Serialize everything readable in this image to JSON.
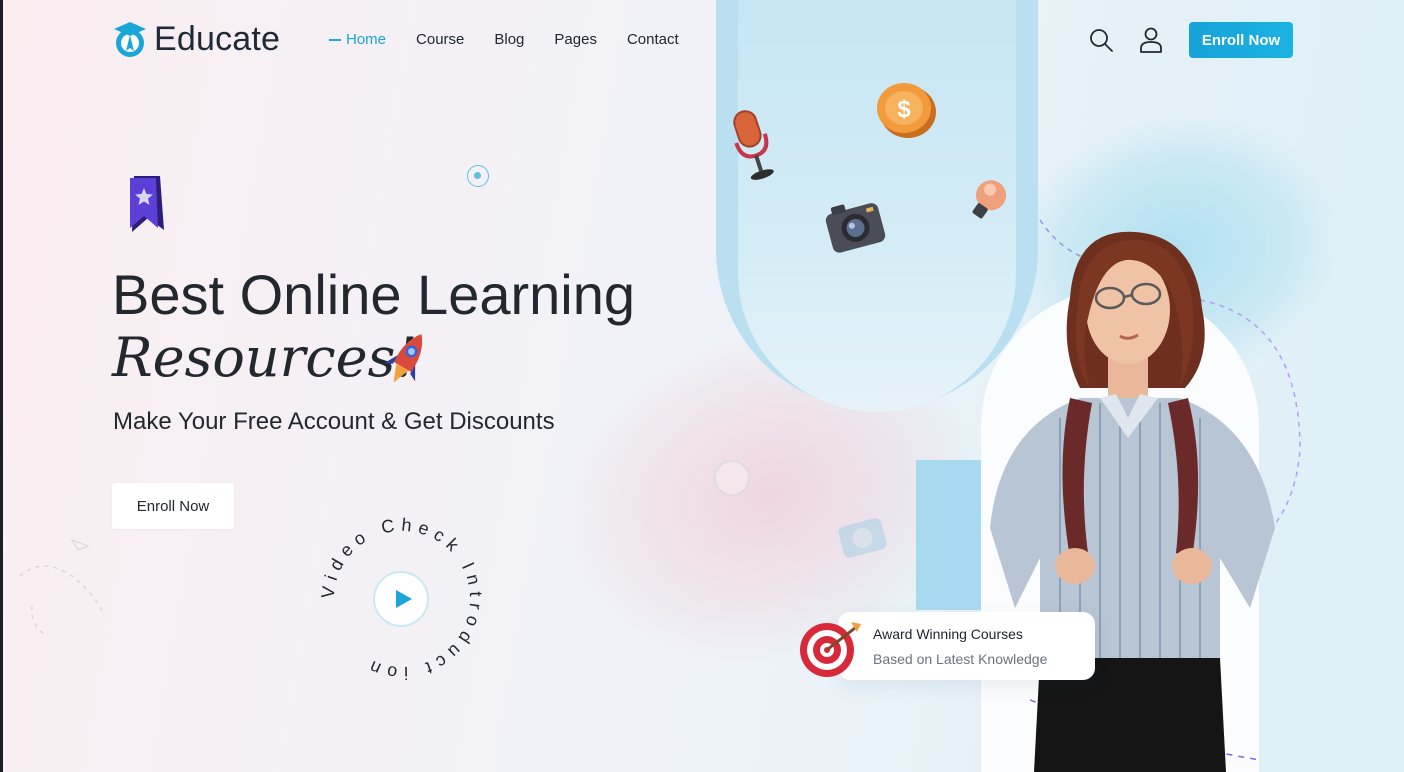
{
  "header": {
    "logo_text": "Educate",
    "nav": [
      {
        "label": "Home",
        "active": true
      },
      {
        "label": "Course",
        "active": false
      },
      {
        "label": "Blog",
        "active": false
      },
      {
        "label": "Pages",
        "active": false
      },
      {
        "label": "Contact",
        "active": false
      }
    ],
    "enroll_label": "Enroll Now"
  },
  "hero": {
    "title_line1": "Best Online Learning",
    "title_line2": "Resources!",
    "subtitle": "Make Your Free Account & Get Discounts",
    "cta_label": "Enroll Now",
    "video_circle_text": "Video Check Introduct ion"
  },
  "award": {
    "title": "Award Winning Courses",
    "subtitle": "Based on Latest Knowledge"
  },
  "icons": {
    "logo": "graduation-cap-icon",
    "search": "search-icon",
    "user": "user-icon",
    "bookmark": "bookmark-star-icon",
    "rocket": "rocket-icon",
    "play": "play-icon",
    "microphone": "microphone-icon",
    "coin": "dollar-coin-icon",
    "camera": "camera-icon",
    "bulb": "lightbulb-icon",
    "target": "target-icon"
  },
  "colors": {
    "accent": "#1aa6d6",
    "text_dark": "#23272e",
    "bookmark_purple": "#5b3fd6"
  }
}
